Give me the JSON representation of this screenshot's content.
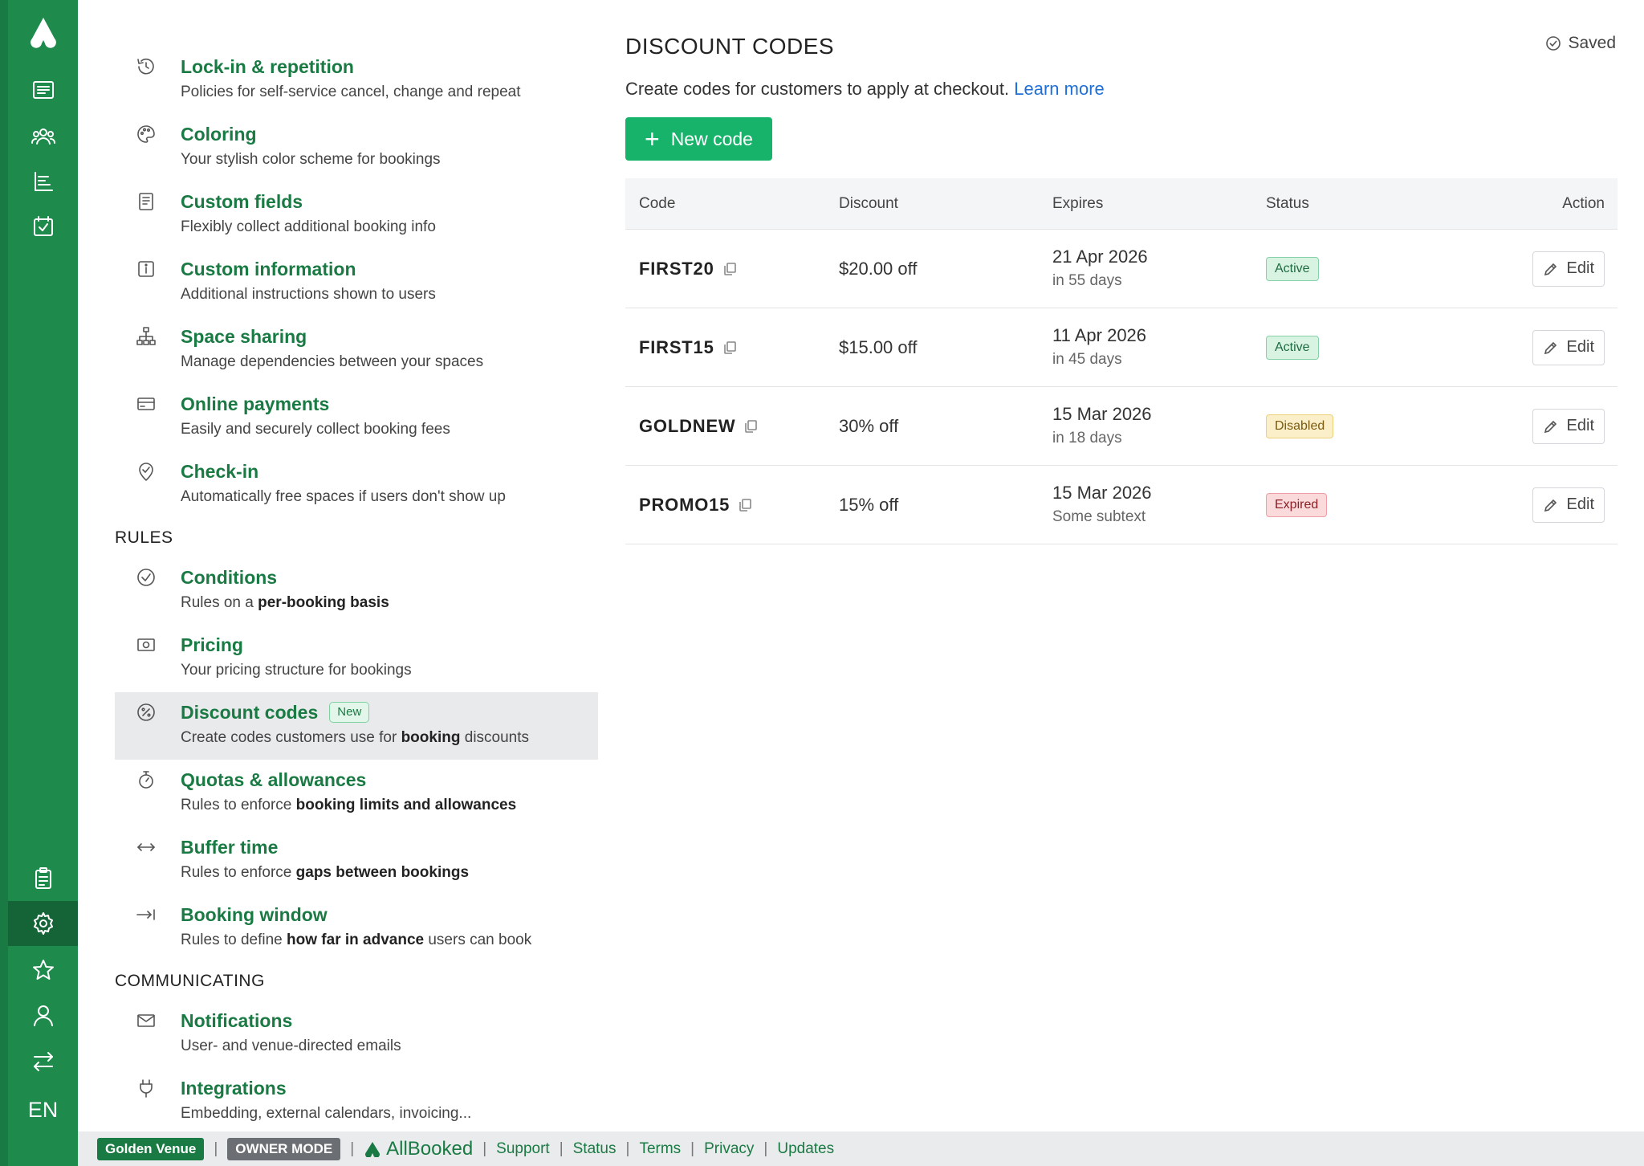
{
  "rail": {
    "lang": "EN"
  },
  "nav": {
    "items_top": [
      {
        "title": "Lock-in & repetition",
        "desc": "Policies for self-service cancel, change and repeat",
        "icon": "history-icon"
      },
      {
        "title": "Coloring",
        "desc": "Your stylish color scheme for bookings",
        "icon": "palette-icon"
      },
      {
        "title": "Custom fields",
        "desc": "Flexibly collect additional booking info",
        "icon": "form-icon"
      },
      {
        "title": "Custom information",
        "desc": "Additional instructions shown to users",
        "icon": "info-icon"
      },
      {
        "title": "Space sharing",
        "desc": "Manage dependencies between your spaces",
        "icon": "hierarchy-icon"
      },
      {
        "title": "Online payments",
        "desc": "Easily and securely collect booking fees",
        "icon": "credit-card-icon"
      },
      {
        "title": "Check-in",
        "desc": "Automatically free spaces if users don't show up",
        "icon": "location-check-icon"
      }
    ],
    "rules_heading": "RULES",
    "rules": {
      "conditions": {
        "title": "Conditions",
        "desc_pre": "Rules on a ",
        "desc_bold": "per-booking basis",
        "desc_post": ""
      },
      "pricing": {
        "title": "Pricing",
        "desc": "Your pricing structure for bookings"
      },
      "discount": {
        "title": "Discount codes",
        "badge": "New",
        "desc_pre": "Create codes customers use for ",
        "desc_bold": "booking",
        "desc_post": " discounts"
      },
      "quotas": {
        "title": "Quotas & allowances",
        "desc_pre": "Rules to enforce ",
        "desc_bold": "booking limits and allowances",
        "desc_post": ""
      },
      "buffer": {
        "title": "Buffer time",
        "desc_pre": "Rules to enforce ",
        "desc_bold": "gaps between bookings",
        "desc_post": ""
      },
      "window": {
        "title": "Booking window",
        "desc_pre": "Rules to define ",
        "desc_bold": "how far in advance",
        "desc_post": " users can book"
      }
    },
    "comm_heading": "COMMUNICATING",
    "comm": {
      "notifications": {
        "title": "Notifications",
        "desc": "User- and venue-directed emails"
      },
      "integrations": {
        "title": "Integrations",
        "desc": "Embedding, external calendars, invoicing..."
      }
    }
  },
  "main": {
    "title": "DISCOUNT CODES",
    "saved": "Saved",
    "intro": "Create codes for customers to apply at checkout.",
    "learn_more": "Learn more",
    "new_code": "New code",
    "columns": [
      "Code",
      "Discount",
      "Expires",
      "Status",
      "Action"
    ],
    "rows": [
      {
        "code": "FIRST20",
        "discount": "$20.00 off",
        "expires": "21 Apr 2026",
        "expires_sub": "in 55 days",
        "status": "Active",
        "action": "Edit"
      },
      {
        "code": "FIRST15",
        "discount": "$15.00 off",
        "expires": "11 Apr 2026",
        "expires_sub": "in 45 days",
        "status": "Active",
        "action": "Edit"
      },
      {
        "code": "GOLDNEW",
        "discount": "30% off",
        "expires": "15 Mar 2026",
        "expires_sub": "in 18 days",
        "status": "Disabled",
        "action": "Edit"
      },
      {
        "code": "PROMO15",
        "discount": "15% off",
        "expires": "15 Mar 2026",
        "expires_sub": "Some subtext",
        "status": "Expired",
        "action": "Edit"
      }
    ]
  },
  "footer": {
    "venue": "Golden Venue",
    "mode": "OWNER MODE",
    "brand": "AllBooked",
    "links": [
      "Support",
      "Status",
      "Terms",
      "Privacy",
      "Updates"
    ]
  },
  "colors": {
    "brand_green": "#1e8a4c",
    "button_green": "#17b36a",
    "link_blue": "#1f6fd6"
  }
}
